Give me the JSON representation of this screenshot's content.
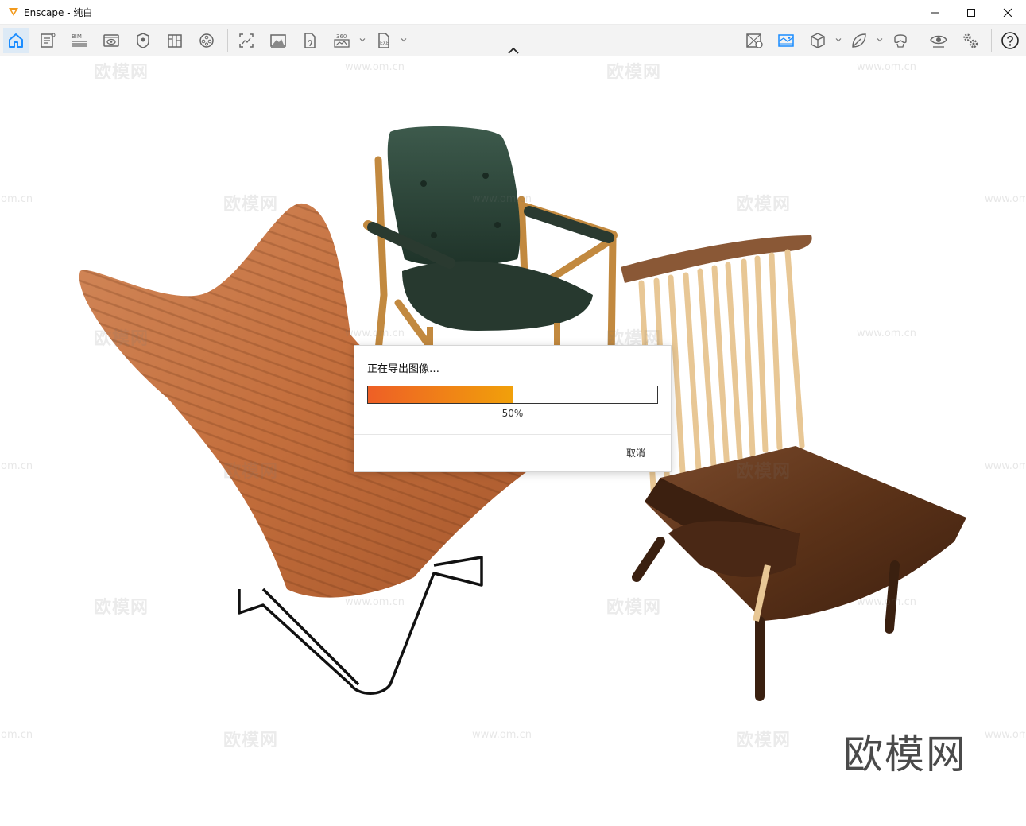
{
  "window": {
    "title": "Enscape - 纯白"
  },
  "toolbar": {
    "left_icons": [
      "home-icon",
      "document-icon",
      "bim-icon",
      "views-icon",
      "capture-icon",
      "library-icon",
      "video-icon"
    ],
    "export_icons": [
      "screenshot-icon",
      "batch-render-icon",
      "export-file-icon",
      "panorama-360-icon",
      "exe-export-icon"
    ],
    "right_icons": [
      "sun-icon",
      "image-icon",
      "cube-icon",
      "leaf-icon",
      "vr-headset-icon",
      "visual-settings-icon",
      "settings-gear-icon",
      "help-icon"
    ]
  },
  "watermarks": {
    "brand": "欧模网",
    "url": "www.om.cn",
    "url_short": "om.cn"
  },
  "dialog": {
    "title": "正在导出图像…",
    "progress_fraction": 0.5,
    "progress_label": "50%",
    "cancel_label": "取消"
  },
  "colors": {
    "accent": "#1a8cff",
    "progress_start": "#ee5f26",
    "progress_end": "#f1a00a"
  }
}
